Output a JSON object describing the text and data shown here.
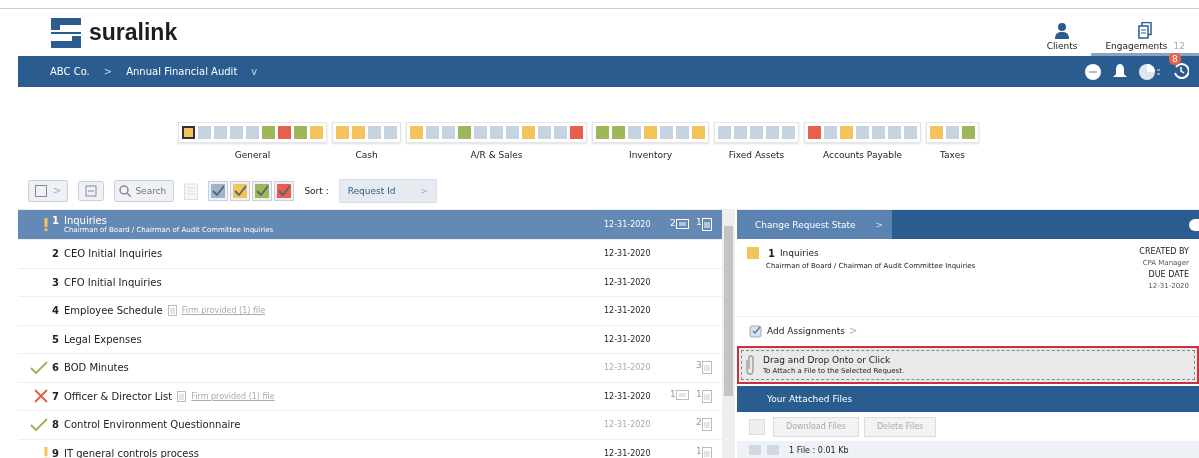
{
  "brand": {
    "name": "suralink"
  },
  "top_nav": [
    {
      "label": "Clients",
      "selected": false,
      "kind": "person"
    },
    {
      "label": "Engagements",
      "count": "12",
      "selected": true,
      "kind": "docs"
    }
  ],
  "breadcrumb": {
    "client": "ABC Co.",
    "separator": ">",
    "engagement": "Annual Financial Audit",
    "caret": "v"
  },
  "nav_icons": {
    "badge": "8"
  },
  "categories": [
    {
      "label": "General",
      "swatches": [
        {
          "color": "#f2c45a",
          "selected": true
        },
        {
          "color": "#c5d3e3",
          "selected": false
        },
        {
          "color": "#c5d3e3",
          "selected": false
        },
        {
          "color": "#c5d3e3",
          "selected": false
        },
        {
          "color": "#c5d3e3",
          "selected": false
        },
        {
          "color": "#9eb75a",
          "selected": false
        },
        {
          "color": "#e8604c",
          "selected": false
        },
        {
          "color": "#9eb75a",
          "selected": false
        },
        {
          "color": "#f2c45a",
          "selected": false
        }
      ]
    },
    {
      "label": "Cash",
      "swatches": [
        {
          "color": "#f2c45a",
          "selected": false
        },
        {
          "color": "#f2c45a",
          "selected": false
        },
        {
          "color": "#c5d3e3",
          "selected": false
        },
        {
          "color": "#c5d3e3",
          "selected": false
        }
      ]
    },
    {
      "label": "A/R & Sales",
      "swatches": [
        {
          "color": "#f2c45a",
          "selected": false
        },
        {
          "color": "#c5d3e3",
          "selected": false
        },
        {
          "color": "#c5d3e3",
          "selected": false
        },
        {
          "color": "#9eb75a",
          "selected": false
        },
        {
          "color": "#c5d3e3",
          "selected": false
        },
        {
          "color": "#c5d3e3",
          "selected": false
        },
        {
          "color": "#c5d3e3",
          "selected": false
        },
        {
          "color": "#f2c45a",
          "selected": false
        },
        {
          "color": "#c5d3e3",
          "selected": false
        },
        {
          "color": "#c5d3e3",
          "selected": false
        },
        {
          "color": "#e8604c",
          "selected": false
        }
      ]
    },
    {
      "label": "Inventory",
      "swatches": [
        {
          "color": "#9eb75a",
          "selected": false
        },
        {
          "color": "#9eb75a",
          "selected": false
        },
        {
          "color": "#c5d3e3",
          "selected": false
        },
        {
          "color": "#f2c45a",
          "selected": false
        },
        {
          "color": "#c5d3e3",
          "selected": false
        },
        {
          "color": "#c5d3e3",
          "selected": false
        },
        {
          "color": "#f2c45a",
          "selected": false
        }
      ]
    },
    {
      "label": "Fixed Assets",
      "swatches": [
        {
          "color": "#c5d3e3",
          "selected": false
        },
        {
          "color": "#c5d3e3",
          "selected": false
        },
        {
          "color": "#c5d3e3",
          "selected": false
        },
        {
          "color": "#c5d3e3",
          "selected": false
        },
        {
          "color": "#c5d3e3",
          "selected": false
        }
      ]
    },
    {
      "label": "Accounts Payable",
      "swatches": [
        {
          "color": "#e8604c",
          "selected": false
        },
        {
          "color": "#c5d3e3",
          "selected": false
        },
        {
          "color": "#f2c45a",
          "selected": false
        },
        {
          "color": "#c5d3e3",
          "selected": false
        },
        {
          "color": "#c5d3e3",
          "selected": false
        },
        {
          "color": "#c5d3e3",
          "selected": false
        },
        {
          "color": "#c5d3e3",
          "selected": false
        }
      ]
    },
    {
      "label": "Taxes",
      "swatches": [
        {
          "color": "#f2c45a",
          "selected": false
        },
        {
          "color": "#c5d3e3",
          "selected": false
        },
        {
          "color": "#9eb75a",
          "selected": false
        }
      ]
    }
  ],
  "toolbar": {
    "expand": ">",
    "search": {
      "placeholder": "Search"
    },
    "filters": [
      {
        "color": "#9fb3cc",
        "checked": true
      },
      {
        "color": "#f2c45a",
        "checked": true
      },
      {
        "color": "#9eb75a",
        "checked": true
      },
      {
        "color": "#e8604c",
        "checked": true
      }
    ],
    "sort_label": "Sort :",
    "sort_value": "Request Id",
    "sort_caret": ">"
  },
  "requests": [
    {
      "number": "1",
      "title": "Inquiries",
      "subtitle": "Chairman of Board / Chairman of Audit Committee Inquiries",
      "kind": "warning",
      "date": "12-31-2020",
      "comments": "2",
      "files": "1",
      "selected": true
    },
    {
      "number": "2",
      "title": "CEO Initial Inquiries",
      "date": "12-31-2020",
      "selected": false
    },
    {
      "number": "3",
      "title": "CFO Initial Inquiries",
      "date": "12-31-2020",
      "selected": false
    },
    {
      "number": "4",
      "title": "Employee Schedule",
      "note": "Firm provided (1) file",
      "date": "12-31-2020",
      "selected": false
    },
    {
      "number": "5",
      "title": "Legal Expenses",
      "date": "12-31-2020",
      "selected": false
    },
    {
      "number": "6",
      "title": "BOD Minutes",
      "kind": "done",
      "date": "12-31-2020",
      "files": "3",
      "selected": false
    },
    {
      "number": "7",
      "title": "Officer & Director List",
      "kind": "rejected",
      "note": "Firm provided (1) file",
      "date": "12-31-2020",
      "comments": "1",
      "files": "1",
      "selected": false
    },
    {
      "number": "8",
      "title": "Control Environment Questionnaire",
      "kind": "done",
      "date": "12-31-2020",
      "files": "2",
      "selected": false
    },
    {
      "number": "9",
      "title": "IT general controls process",
      "kind": "warning",
      "date": "12-31-2020",
      "files": "1",
      "selected": false
    }
  ],
  "detail": {
    "tab": "Change Request State",
    "tab_caret": ">",
    "color": "#f2c45a",
    "number": "1",
    "title": "Inquiries",
    "subtitle": "Chairman of Board / Chairman of Audit Committee Inquiries",
    "created_by_label": "CREATED BY",
    "created_by": "CPA Manager",
    "due_label": "DUE DATE",
    "due": "12-31-2020",
    "assign": "Add Assignments",
    "assign_caret": ">",
    "drop_title": "Drag and Drop Onto or Click",
    "drop_hint": "To Attach a File to the Selected Request.",
    "files_header": "Your Attached Files",
    "select_all_checked": false,
    "download": "Download Files",
    "delete": "Delete Files",
    "buttons_disabled": true,
    "file_summary": "1 File : 0.01 Kb"
  }
}
